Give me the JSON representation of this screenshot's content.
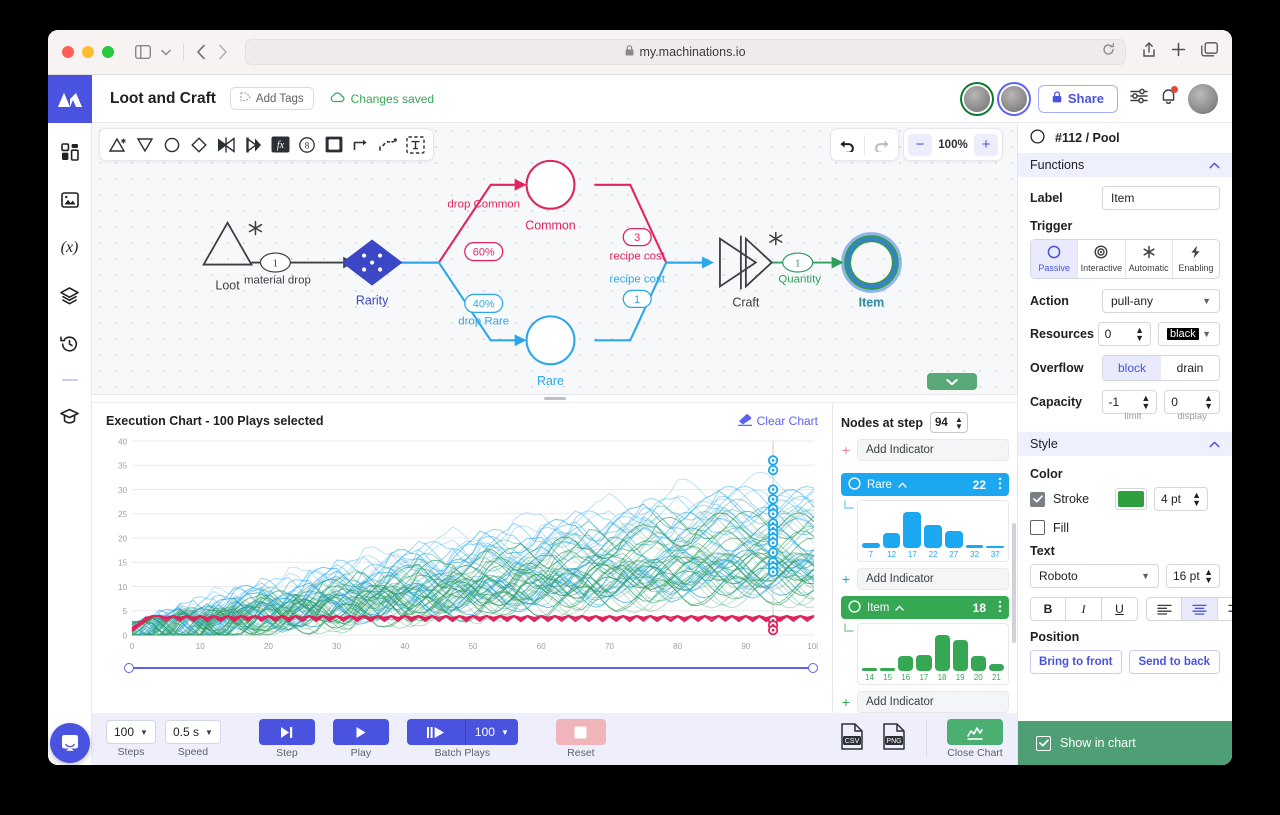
{
  "browser": {
    "url": "my.machinations.io",
    "lock_icon": "lock-icon",
    "reload_icon": "reload-icon",
    "sidebar_icon": "sidebar-toggle-icon",
    "back_icon": "back-arrow-icon",
    "forward_icon": "forward-arrow-icon",
    "share_icon": "share-icon",
    "new_tab_icon": "plus-icon",
    "tabs_icon": "tabs-icon"
  },
  "header": {
    "title": "Loot and Craft",
    "add_tags": "Add Tags",
    "saved_status": "Changes saved",
    "share_label": "Share",
    "settings_icon": "sliders-icon",
    "bell_icon": "bell-icon",
    "logo_icon": "machinations-logo"
  },
  "left_rail": [
    {
      "name": "sidebar-item-dashboard",
      "icon": "grid-icon"
    },
    {
      "name": "sidebar-item-images",
      "icon": "image-icon"
    },
    {
      "name": "sidebar-item-variables",
      "icon": "formula-icon"
    },
    {
      "name": "sidebar-item-layers",
      "icon": "layers-icon"
    },
    {
      "name": "sidebar-item-history",
      "icon": "history-icon"
    },
    {
      "name": "sidebar-item-academy",
      "icon": "graduation-cap-icon"
    }
  ],
  "canvas": {
    "tools": [
      {
        "name": "tool-source",
        "icon": "triangle-up-star-icon"
      },
      {
        "name": "tool-drain",
        "icon": "triangle-down-icon"
      },
      {
        "name": "tool-pool",
        "icon": "circle-icon"
      },
      {
        "name": "tool-gate",
        "icon": "diamond-icon"
      },
      {
        "name": "tool-converter",
        "icon": "converter-icon"
      },
      {
        "name": "tool-trader",
        "icon": "trader-icon"
      },
      {
        "name": "tool-formula",
        "icon": "fx-icon"
      },
      {
        "name": "tool-register",
        "icon": "register-icon"
      },
      {
        "name": "tool-end-condition",
        "icon": "square-icon"
      },
      {
        "name": "tool-resource-connection",
        "icon": "elbow-connection-icon"
      },
      {
        "name": "tool-state-connection",
        "icon": "dashed-connection-icon"
      },
      {
        "name": "tool-label",
        "icon": "text-box-icon"
      }
    ],
    "undo_icon": "undo-icon",
    "redo_icon": "redo-icon",
    "zoom_out": "−",
    "zoom_level": "100%",
    "zoom_in": "+",
    "collapse_icon": "chevron-down-icon",
    "nodes": [
      {
        "name": "node-loot",
        "label": "Loot",
        "color": "#3c4043"
      },
      {
        "name": "node-rarity",
        "label": "Rarity",
        "color": "#3b47c4"
      },
      {
        "name": "node-common",
        "label": "Common",
        "color": "#e0245e"
      },
      {
        "name": "node-rare",
        "label": "Rare",
        "color": "#2ca8ea"
      },
      {
        "name": "node-craft",
        "label": "Craft",
        "color": "#3c4043"
      },
      {
        "name": "node-item",
        "label": "Item",
        "color": "#2f9e5f"
      }
    ],
    "edges": [
      {
        "name": "edge-material-drop",
        "label": "material drop",
        "value": "1",
        "color": "#3c4043"
      },
      {
        "name": "edge-drop-common",
        "label": "drop Common",
        "value": "60%",
        "color": "#e0245e"
      },
      {
        "name": "edge-drop-rare",
        "label": "drop Rare",
        "value": "40%",
        "color": "#2ca8ea"
      },
      {
        "name": "edge-recipe-cost-common",
        "label": "recipe cost",
        "value": "3",
        "color": "#e0245e"
      },
      {
        "name": "edge-recipe-cost-rare",
        "label": "recipe cost",
        "value": "1",
        "color": "#2ca8ea"
      },
      {
        "name": "edge-quantity",
        "label": "Quantity",
        "value": "1",
        "color": "#2f9e5f"
      }
    ]
  },
  "chart": {
    "title": "Execution Chart  - 100 Plays selected",
    "clear_label": "Clear Chart",
    "clear_icon": "eraser-icon"
  },
  "chart_data": {
    "type": "line",
    "title": "Execution Chart  - 100 Plays selected",
    "xlabel": "",
    "ylabel": "",
    "xlim": [
      0,
      100
    ],
    "ylim": [
      0,
      40
    ],
    "xticks": [
      0,
      10,
      20,
      30,
      40,
      50,
      60,
      70,
      80,
      90,
      100
    ],
    "yticks": [
      0,
      5,
      10,
      15,
      20,
      25,
      30,
      35,
      40
    ],
    "grid": true,
    "legend": "none",
    "cursor_step": 94,
    "series": [
      {
        "name": "Rare",
        "color": "#2ca8ea",
        "final_value": 22,
        "values": [
          0,
          0,
          1,
          1,
          2,
          2,
          2,
          3,
          3,
          4,
          4,
          4,
          5,
          5,
          5,
          6,
          6,
          6,
          6,
          7,
          7,
          7,
          7,
          8,
          8,
          8,
          9,
          9,
          9,
          9,
          10,
          10,
          10,
          10,
          11,
          11,
          11,
          11,
          12,
          12,
          12,
          12,
          13,
          13,
          13,
          13,
          13,
          14,
          14,
          14,
          14,
          15,
          15,
          15,
          15,
          15,
          16,
          16,
          16,
          16,
          17,
          17,
          17,
          17,
          17,
          18,
          18,
          18,
          18,
          18,
          19,
          19,
          19,
          19,
          19,
          20,
          20,
          20,
          20,
          20,
          21,
          21,
          21,
          21,
          21,
          21,
          22,
          22,
          22,
          22,
          22,
          22,
          22,
          22,
          22,
          22,
          22,
          22,
          22,
          22,
          22
        ]
      },
      {
        "name": "Item",
        "color": "#2f9e5f",
        "final_value": 18,
        "values": [
          0,
          0,
          0,
          1,
          1,
          1,
          1,
          2,
          2,
          2,
          2,
          3,
          3,
          3,
          3,
          4,
          4,
          4,
          4,
          5,
          5,
          5,
          5,
          5,
          6,
          6,
          6,
          6,
          7,
          7,
          7,
          7,
          7,
          8,
          8,
          8,
          8,
          9,
          9,
          9,
          9,
          9,
          10,
          10,
          10,
          10,
          10,
          11,
          11,
          11,
          11,
          11,
          12,
          12,
          12,
          12,
          12,
          13,
          13,
          13,
          13,
          13,
          14,
          14,
          14,
          14,
          14,
          15,
          15,
          15,
          15,
          15,
          16,
          16,
          16,
          16,
          16,
          17,
          17,
          17,
          17,
          17,
          17,
          18,
          18,
          18,
          18,
          18,
          18,
          18,
          18,
          18,
          18,
          18,
          18,
          18,
          18,
          18,
          18,
          18,
          18
        ]
      },
      {
        "name": "Common",
        "color": "#e0245e",
        "final_value": 3,
        "values": [
          0,
          1,
          2,
          3,
          3,
          2,
          3,
          2,
          3,
          2,
          3,
          2,
          3,
          2,
          3,
          2,
          3,
          2,
          3,
          2,
          3,
          2,
          3,
          2,
          3,
          2,
          3,
          2,
          3,
          2,
          3,
          2,
          3,
          2,
          3,
          2,
          3,
          2,
          3,
          2,
          3,
          2,
          3,
          2,
          3,
          2,
          3,
          2,
          3,
          2,
          3,
          2,
          3,
          2,
          3,
          2,
          3,
          2,
          3,
          2,
          3,
          2,
          3,
          2,
          3,
          2,
          3,
          2,
          3,
          2,
          3,
          2,
          3,
          2,
          3,
          2,
          3,
          2,
          3,
          2,
          3,
          2,
          3,
          2,
          3,
          2,
          3,
          2,
          3,
          2,
          3,
          2,
          3,
          2,
          3,
          2,
          3,
          2,
          3,
          2,
          3
        ]
      }
    ],
    "cursor_markers_blue": [
      36,
      34,
      30,
      28,
      26,
      25,
      23,
      22,
      21,
      20,
      19,
      17,
      15,
      14,
      13
    ],
    "cursor_markers_red": [
      3,
      2,
      1
    ]
  },
  "nodes_panel": {
    "title": "Nodes at step",
    "step_value": "94",
    "add_indicator": "Add Indicator",
    "menu_icon": "kebab-menu-icon",
    "cards": [
      {
        "name": "Rare",
        "count": "22",
        "color": "#1ca8f0",
        "bar_color": "#1ca8f0",
        "histogram": {
          "labels": [
            "7",
            "12",
            "17",
            "22",
            "27",
            "32",
            "37"
          ],
          "values": [
            3,
            10,
            24,
            15,
            11,
            2,
            1
          ]
        }
      },
      {
        "name": "Item",
        "count": "18",
        "color": "#36a853",
        "bar_color": "#36a853",
        "histogram": {
          "labels": [
            "14",
            "15",
            "16",
            "17",
            "18",
            "19",
            "20",
            "21"
          ],
          "values": [
            2,
            2,
            9,
            10,
            22,
            19,
            9,
            4
          ]
        }
      }
    ]
  },
  "controls": {
    "steps_value": "100",
    "steps_label": "Steps",
    "speed_value": "0.5 s",
    "speed_label": "Speed",
    "step_label": "Step",
    "step_icon": "step-forward-icon",
    "play_label": "Play",
    "play_icon": "play-icon",
    "batch_label": "Batch Plays",
    "batch_icon": "batch-play-icon",
    "batch_value": "100",
    "reset_label": "Reset",
    "reset_icon": "stop-square-icon",
    "csv_label": "CSV",
    "png_label": "PNG",
    "close_chart_label": "Close Chart",
    "close_chart_icon": "chart-icon"
  },
  "inspector": {
    "node_title": "#112 / Pool",
    "node_icon": "circle-outline-icon",
    "functions": {
      "section_title": "Functions",
      "label_label": "Label",
      "label_value": "Item",
      "trigger_label": "Trigger",
      "triggers": [
        {
          "label": "Passive",
          "icon": "circle-icon",
          "active": true
        },
        {
          "label": "Interactive",
          "icon": "target-icon",
          "active": false
        },
        {
          "label": "Automatic",
          "icon": "asterisk-icon",
          "active": false
        },
        {
          "label": "Enabling",
          "icon": "bolt-icon",
          "active": false
        }
      ],
      "action_label": "Action",
      "action_value": "pull-any",
      "resources_label": "Resources",
      "resources_value": "0",
      "resources_color": "black",
      "overflow_label": "Overflow",
      "overflow_options": [
        "block",
        "drain"
      ],
      "overflow_selected": "block",
      "capacity_label": "Capacity",
      "capacity_limit": "-1",
      "capacity_display": "0",
      "capacity_limit_caption": "limit",
      "capacity_display_caption": "display"
    },
    "style": {
      "section_title": "Style",
      "color_label": "Color",
      "stroke_label": "Stroke",
      "stroke_checked": true,
      "stroke_color": "#2f9e3f",
      "stroke_width": "4 pt",
      "fill_label": "Fill",
      "fill_checked": false,
      "text_label": "Text",
      "font_family": "Roboto",
      "font_size": "16 pt",
      "bold": "B",
      "italic": "I",
      "underline": "U",
      "align_selected": "center",
      "position_label": "Position",
      "bring_to_front": "Bring to front",
      "send_to_back": "Send to back"
    },
    "show_in_chart": "Show in chart",
    "show_in_chart_checked": true
  },
  "intercom_icon": "chat-bubble-icon"
}
